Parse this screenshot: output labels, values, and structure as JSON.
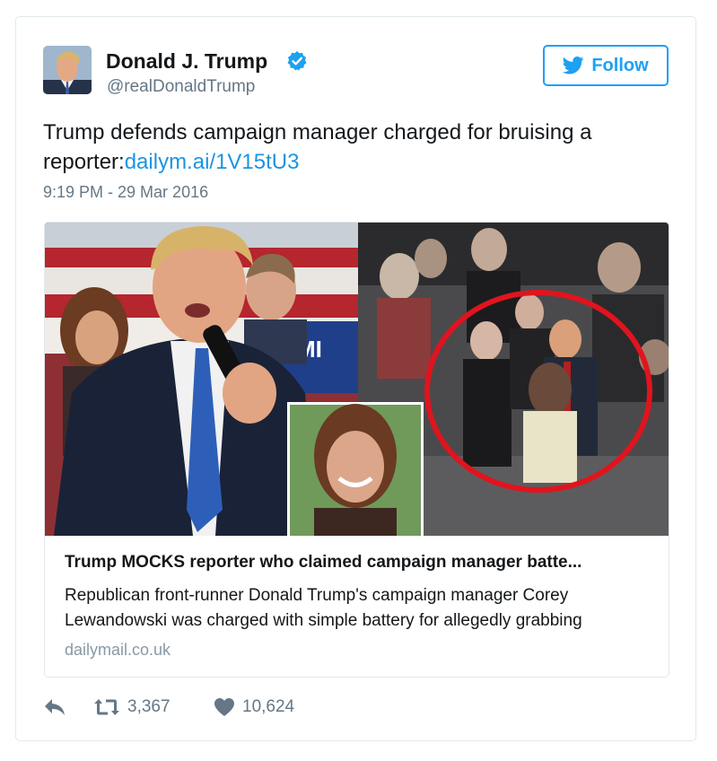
{
  "header": {
    "display_name": "Donald J. Trump",
    "screen_name": "@realDonaldTrump",
    "verified": true,
    "follow_label": "Follow"
  },
  "tweet": {
    "text": "Trump defends campaign manager charged for bruising a reporter:",
    "link_text": "dailym.ai/1V15tU3",
    "timestamp": "9:19 PM - 29 Mar 2016"
  },
  "card": {
    "title": "Trump MOCKS reporter who claimed campaign manager batte...",
    "description": "Republican front-runner Donald Trump's campaign manager Corey Lewandowski was charged with simple battery for allegedly grabbing",
    "domain": "dailymail.co.uk"
  },
  "actions": {
    "retweets": "3,367",
    "likes": "10,624"
  },
  "colors": {
    "accent": "#1da1f2",
    "link": "#1b95e0",
    "muted": "#657786",
    "border": "#e1e8ed",
    "circle": "#e0141e"
  }
}
